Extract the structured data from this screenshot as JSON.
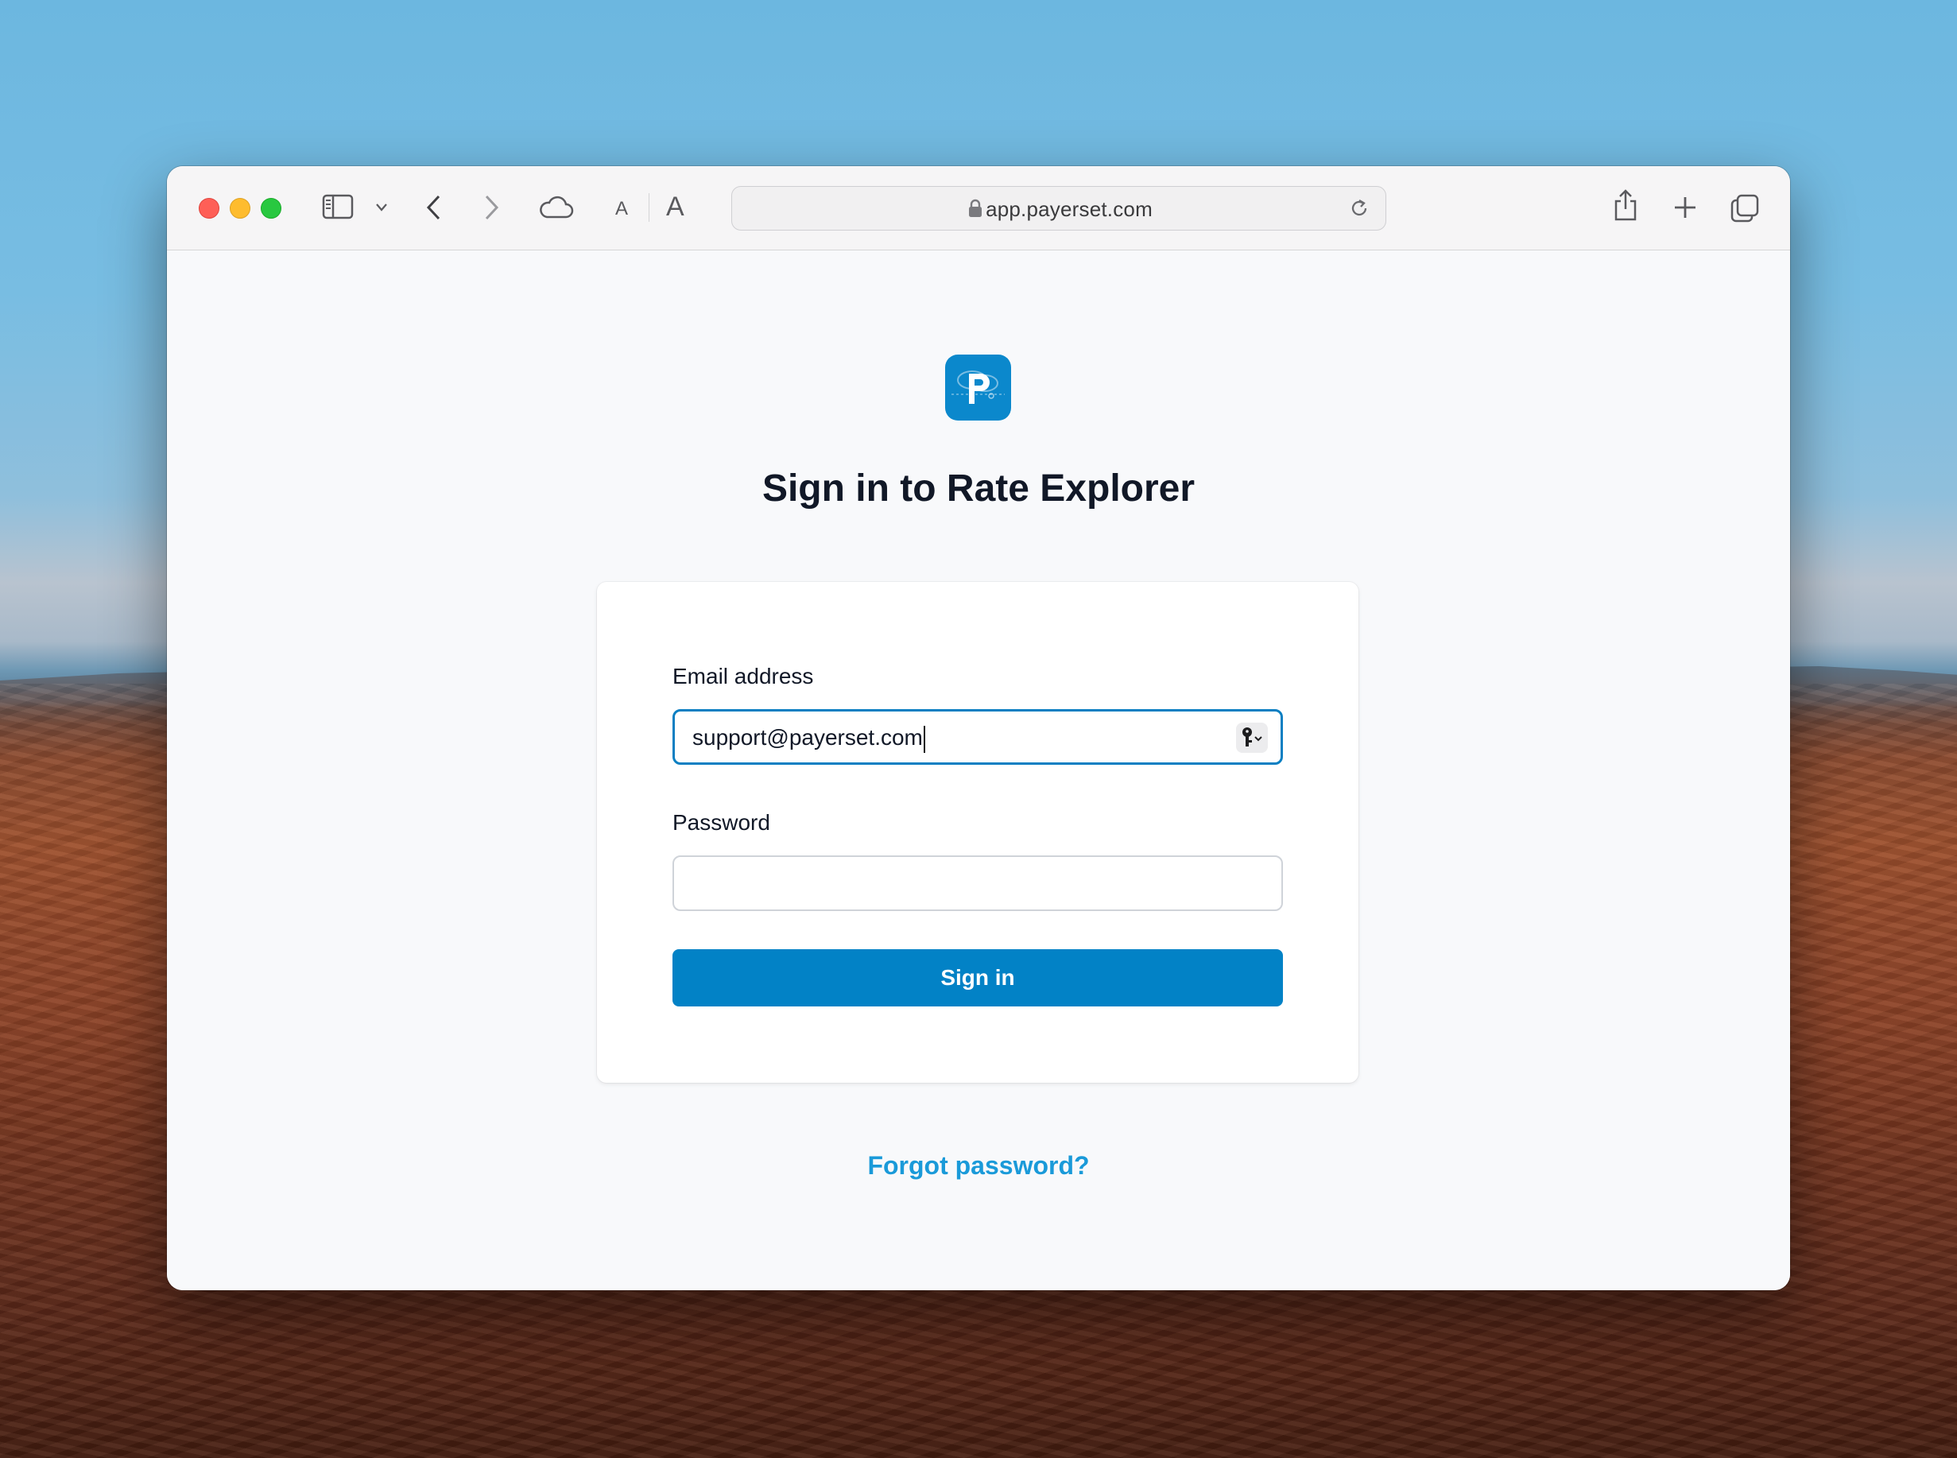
{
  "browser": {
    "url": "app.payerset.com",
    "text_size_small": "A",
    "text_size_large": "A"
  },
  "page": {
    "title": "Sign in to Rate Explorer",
    "email_label": "Email address",
    "email_value": "support@payerset.com",
    "password_label": "Password",
    "password_value": "",
    "signin_label": "Sign in",
    "forgot_label": "Forgot password?"
  },
  "colors": {
    "accent": "#0282c6",
    "link": "#1a9ad9",
    "logo": "#0b88cc"
  }
}
